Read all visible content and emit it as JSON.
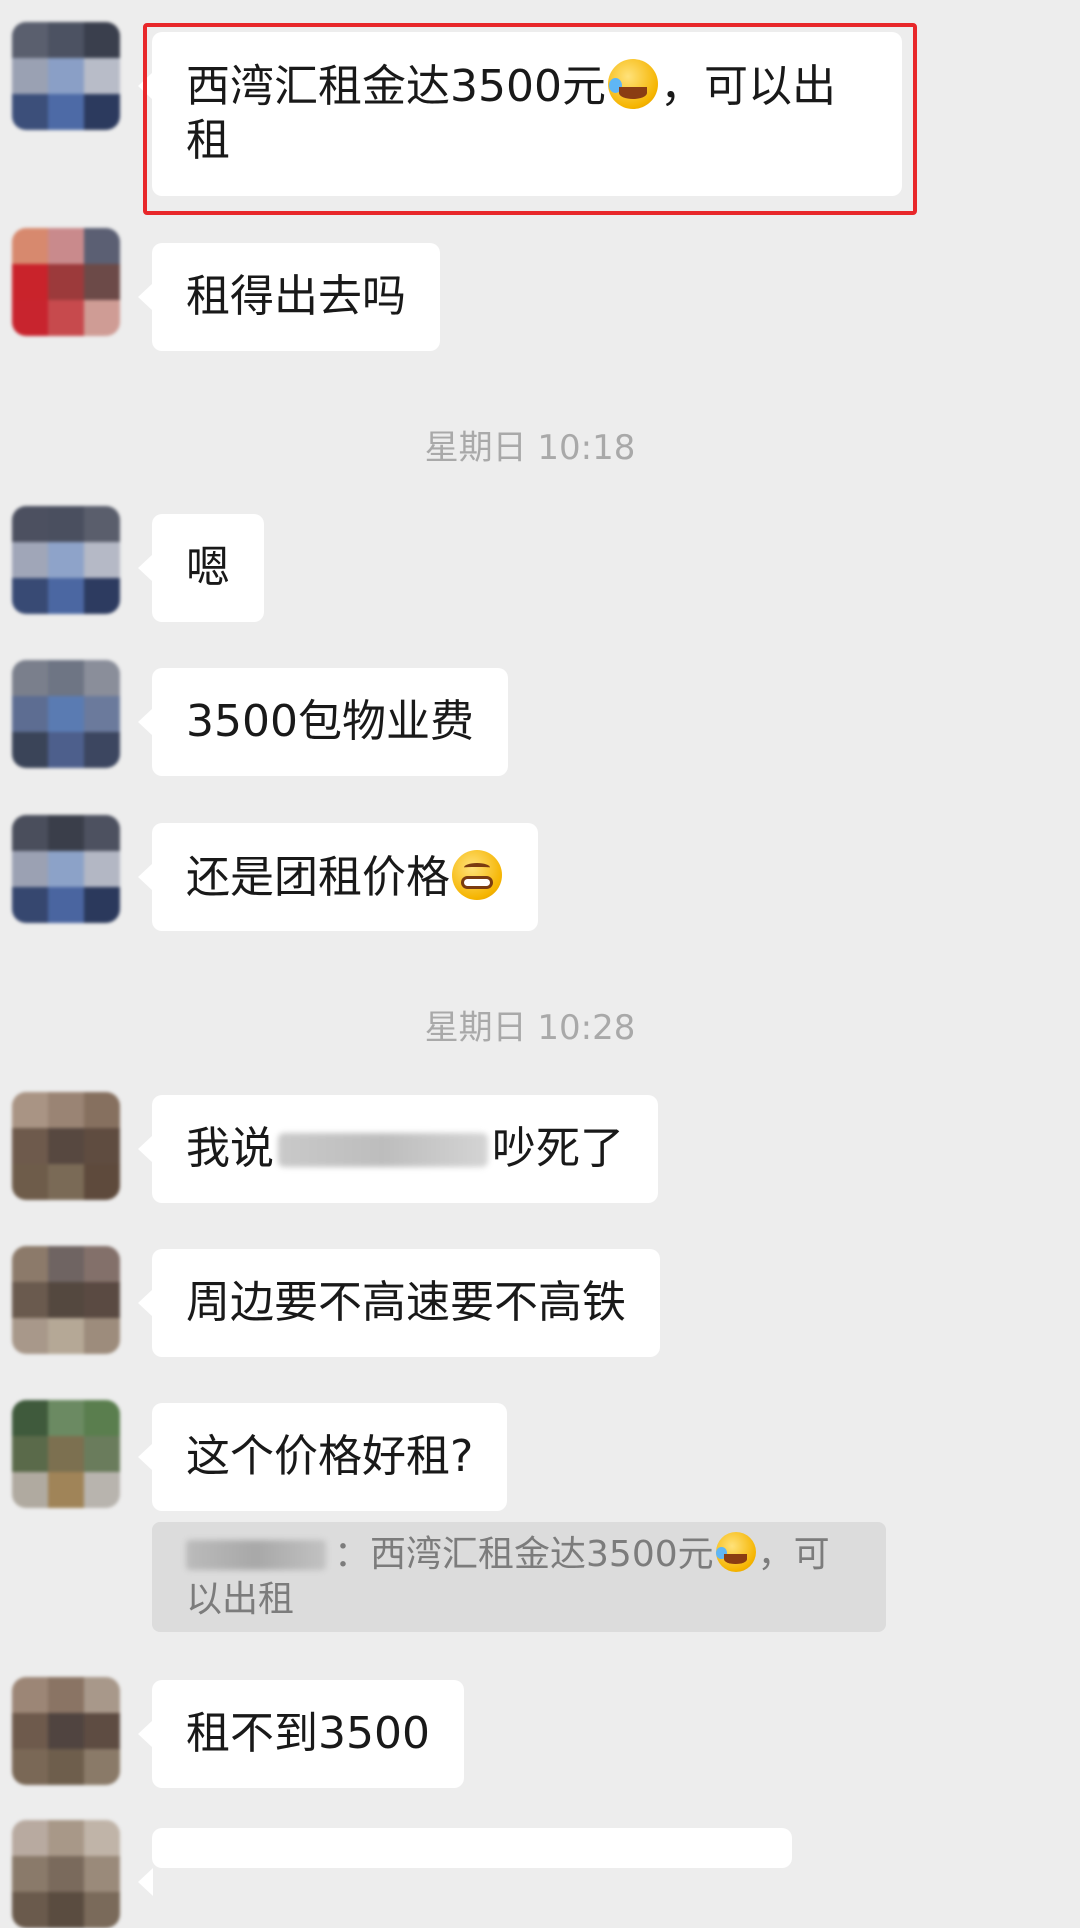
{
  "messages": [
    {
      "text": "西湾汇租金达3500元",
      "emoji": "laughing-crying-emoji",
      "text_after": "，可以出租"
    },
    {
      "text": "租得出去吗"
    },
    {
      "text": "嗯"
    },
    {
      "text": "3500包物业费"
    },
    {
      "text": "还是团租价格",
      "emoji": "grinning-emoji"
    },
    {
      "text_before": "我说",
      "text_after": "吵死了"
    },
    {
      "text": "周边要不高速要不高铁"
    },
    {
      "text": "这个价格好租?"
    },
    {
      "text": "租不到3500"
    }
  ],
  "timestamps": [
    "星期日 10:18",
    "星期日 10:28"
  ],
  "quote": {
    "separator": "：",
    "text": "西湾汇租金达3500元",
    "emoji": "laughing-crying-emoji",
    "text_after": "，可以出租"
  },
  "colors": {
    "background": "#ededed",
    "bubble": "#ffffff",
    "highlight_border": "#e8272a",
    "timestamp_text": "#a9a9a9",
    "quote_bg": "#dcdcdc"
  }
}
